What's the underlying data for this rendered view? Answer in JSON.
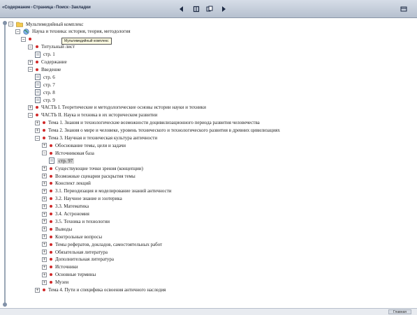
{
  "toolbar": {
    "tabs": [
      "«Содержание",
      "Страница",
      "Поиск",
      "Закладки"
    ],
    "separator": "›"
  },
  "tooltip": "Мультимедийный комплекс",
  "tree": [
    {
      "label": "Мультимедийный комплекс",
      "expander": "⊟",
      "icon": "folder-icon"
    },
    {
      "label": "Наука и техника: история, теория, методология",
      "expander": "⊟",
      "icon": "globe-icon"
    },
    {
      "label": "",
      "expander": "⊟",
      "icon": "bullet-icon"
    },
    {
      "label": "Титульный лист",
      "expander": "⊟",
      "icon": "bullet-icon"
    },
    {
      "label": "стр. 1",
      "expander": "",
      "icon": "page-icon"
    },
    {
      "label": "Содержание",
      "expander": "⊞",
      "icon": "bullet-icon"
    },
    {
      "label": "Введение",
      "expander": "⊟",
      "icon": "bullet-icon"
    },
    {
      "label": "стр. 6",
      "expander": "",
      "icon": "page-icon"
    },
    {
      "label": "стр. 7",
      "expander": "",
      "icon": "page-icon"
    },
    {
      "label": "стр. 8",
      "expander": "",
      "icon": "page-icon"
    },
    {
      "label": "стр. 9",
      "expander": "",
      "icon": "page-icon"
    },
    {
      "label": "ЧАСТЬ I. Теоретические и методологические основы истории науки и техники",
      "expander": "⊞",
      "icon": "bullet-icon"
    },
    {
      "label": "ЧАСТЬ II. Наука и техника в их историческом развитии",
      "expander": "⊟",
      "icon": "bullet-icon"
    },
    {
      "label": "Тема 1. Знания и технологические возможности доцивилизационного периода развития человечества",
      "expander": "⊞",
      "icon": "bullet-icon"
    },
    {
      "label": "Тема 2. Знания о мире и человеке, уровень технического и технологического развития в древних цивилизациях",
      "expander": "⊞",
      "icon": "bullet-icon"
    },
    {
      "label": "Тема 3. Научная и техническая культура античности",
      "expander": "⊟",
      "icon": "bullet-icon"
    },
    {
      "label": "Обоснование темы, цели и задачи",
      "expander": "⊞",
      "icon": "bullet-icon"
    },
    {
      "label": "Источниковая база",
      "expander": "⊟",
      "icon": "bullet-icon"
    },
    {
      "label": "стр. 97",
      "expander": "",
      "icon": "page-icon",
      "selected": true
    },
    {
      "label": "Существующие точки зрения (концепции)",
      "expander": "⊞",
      "icon": "bullet-icon"
    },
    {
      "label": "Возможные сценарии раскрытия темы",
      "expander": "⊞",
      "icon": "bullet-icon"
    },
    {
      "label": "Конспект лекций",
      "expander": "⊞",
      "icon": "bullet-icon"
    },
    {
      "label": "3.1. Периодизация и моделирование знаний античности",
      "expander": "⊞",
      "icon": "bullet-icon"
    },
    {
      "label": "3.2. Научное знание и эзотерика",
      "expander": "⊞",
      "icon": "bullet-icon"
    },
    {
      "label": "3.3. Математика",
      "expander": "⊞",
      "icon": "bullet-icon"
    },
    {
      "label": "3.4. Астрономия",
      "expander": "⊞",
      "icon": "bullet-icon"
    },
    {
      "label": "3.5. Техника и технологии",
      "expander": "⊞",
      "icon": "bullet-icon"
    },
    {
      "label": "Выводы",
      "expander": "⊞",
      "icon": "bullet-icon"
    },
    {
      "label": "Контрольные вопросы",
      "expander": "⊞",
      "icon": "bullet-icon"
    },
    {
      "label": "Темы рефератов, докладов, самостоятельных работ",
      "expander": "⊞",
      "icon": "bullet-icon"
    },
    {
      "label": "Обязательная литература",
      "expander": "⊞",
      "icon": "bullet-icon"
    },
    {
      "label": "Дополнительная литература",
      "expander": "⊞",
      "icon": "bullet-icon"
    },
    {
      "label": "Источники",
      "expander": "⊞",
      "icon": "bullet-icon"
    },
    {
      "label": "Основные термины",
      "expander": "⊞",
      "icon": "bullet-icon"
    },
    {
      "label": "Музеи",
      "expander": "⊞",
      "icon": "bullet-icon"
    },
    {
      "label": "Тема 4. Пути и специфика освоения античного наследия",
      "expander": "⊞",
      "icon": "bullet-icon"
    }
  ],
  "status": {
    "button": "Главная"
  }
}
